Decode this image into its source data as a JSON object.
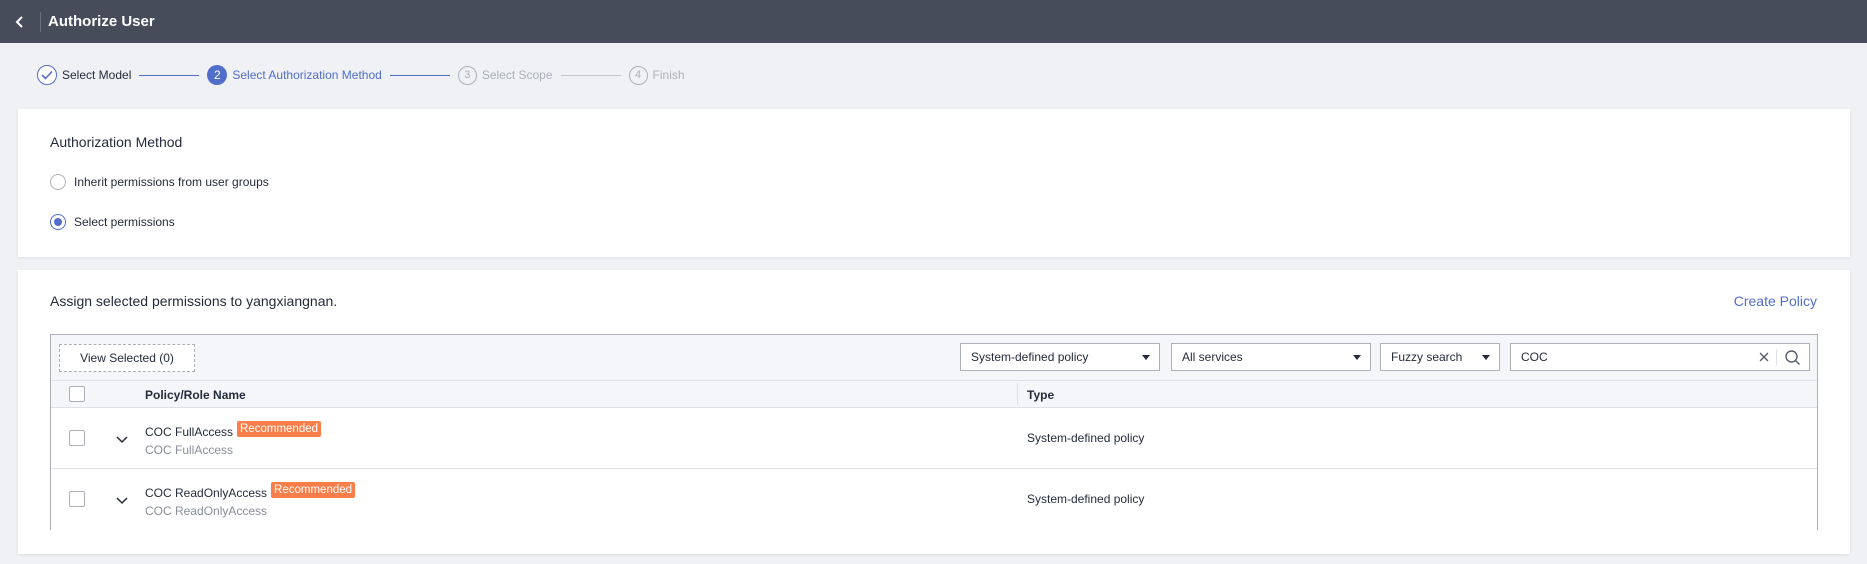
{
  "header": {
    "title": "Authorize User"
  },
  "steps": [
    {
      "number": "1",
      "label": "Select Model"
    },
    {
      "number": "2",
      "label": "Select Authorization Method"
    },
    {
      "number": "3",
      "label": "Select Scope"
    },
    {
      "number": "4",
      "label": "Finish"
    }
  ],
  "auth_method": {
    "title": "Authorization Method",
    "options": [
      {
        "label": "Inherit permissions from user groups",
        "selected": false
      },
      {
        "label": "Select permissions",
        "selected": true
      }
    ]
  },
  "permissions": {
    "assign_text": "Assign selected permissions to yangxiangnan.",
    "create_policy": "Create Policy",
    "view_selected": "View Selected (0)",
    "filters": {
      "policy_type": "System-defined policy",
      "services": "All services",
      "search_mode": "Fuzzy search",
      "search_value": "COC"
    },
    "columns": {
      "name": "Policy/Role Name",
      "type": "Type"
    },
    "rows": [
      {
        "name": "COC FullAccess",
        "badge": "Recommended",
        "description": "COC FullAccess",
        "type": "System-defined policy"
      },
      {
        "name": "COC ReadOnlyAccess",
        "badge": "Recommended",
        "description": "COC ReadOnlyAccess",
        "type": "System-defined policy"
      }
    ]
  },
  "colors": {
    "header_bg": "#464c5a",
    "accent": "#526ecc",
    "badge": "#fa7e4a",
    "page_bg": "#eff1f5"
  }
}
